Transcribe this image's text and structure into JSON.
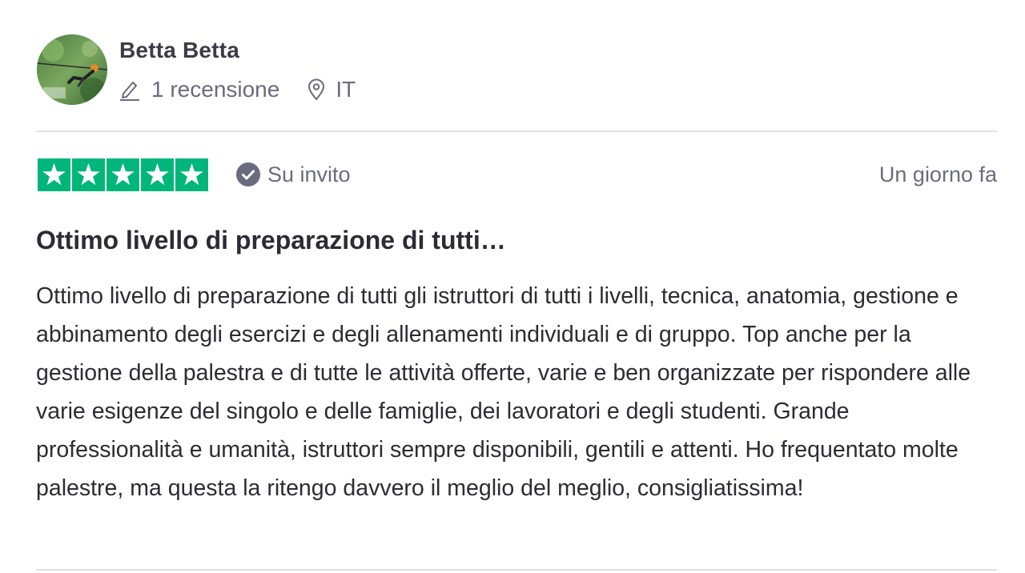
{
  "reviewer": {
    "name": "Betta Betta",
    "reviews_count": "1 recensione",
    "country": "IT"
  },
  "rating": {
    "stars": 5,
    "max_stars": 5,
    "star_color": "#00b67a",
    "star_icon": "star-icon"
  },
  "invite_label": "Su invito",
  "date": "Un giorno fa",
  "review": {
    "title": "Ottimo livello di preparazione di tutti…",
    "body": "Ottimo livello di preparazione di tutti gli istruttori di tutti i livelli, tecnica, anatomia, gestione e abbinamento degli esercizi e degli allenamenti individuali e di gruppo. Top anche per la gestione della palestra e di tutte le attività offerte, varie e ben organizzate per rispondere alle varie esigenze del singolo e delle famiglie, dei lavoratori e degli studenti. Grande professionalità e umanità, istruttori sempre disponibili, gentili e attenti. Ho frequentato molte palestre, ma questa la ritengo davvero il meglio del meglio, consigliatissima!"
  },
  "colors": {
    "text_muted": "#6b6b7f",
    "text_dark": "#2c2c34",
    "divider": "#e2e2e6",
    "badge": "#6b6b7f"
  }
}
